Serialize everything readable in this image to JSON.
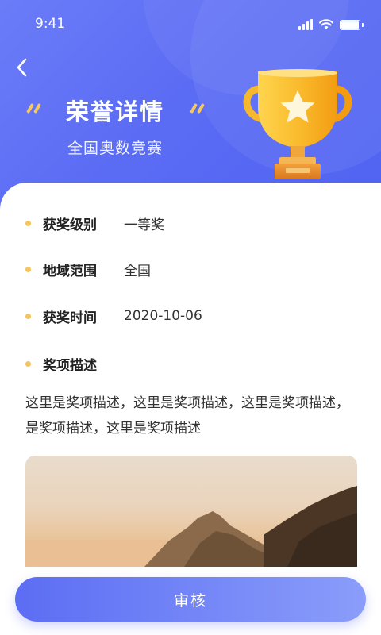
{
  "status_bar": {
    "time": "9:41"
  },
  "header": {
    "title": "荣誉详情",
    "subtitle": "全国奥数竞赛",
    "back_icon": "chevron-left-icon",
    "trophy_icon": "trophy-icon"
  },
  "details": [
    {
      "label": "获奖级别",
      "value": "一等奖"
    },
    {
      "label": "地域范围",
      "value": "全国"
    },
    {
      "label": "获奖时间",
      "value": "2020-10-06"
    },
    {
      "label": "奖项描述",
      "value": ""
    }
  ],
  "description": "这里是奖项描述，这里是奖项描述，这里是奖项描述，是奖项描述，这里是奖项描述",
  "submit_button": {
    "label": "审核"
  },
  "colors": {
    "primary": "#5b6cf4",
    "bullet": "#f5c45a",
    "trophy_gold": "#f7b82e"
  }
}
